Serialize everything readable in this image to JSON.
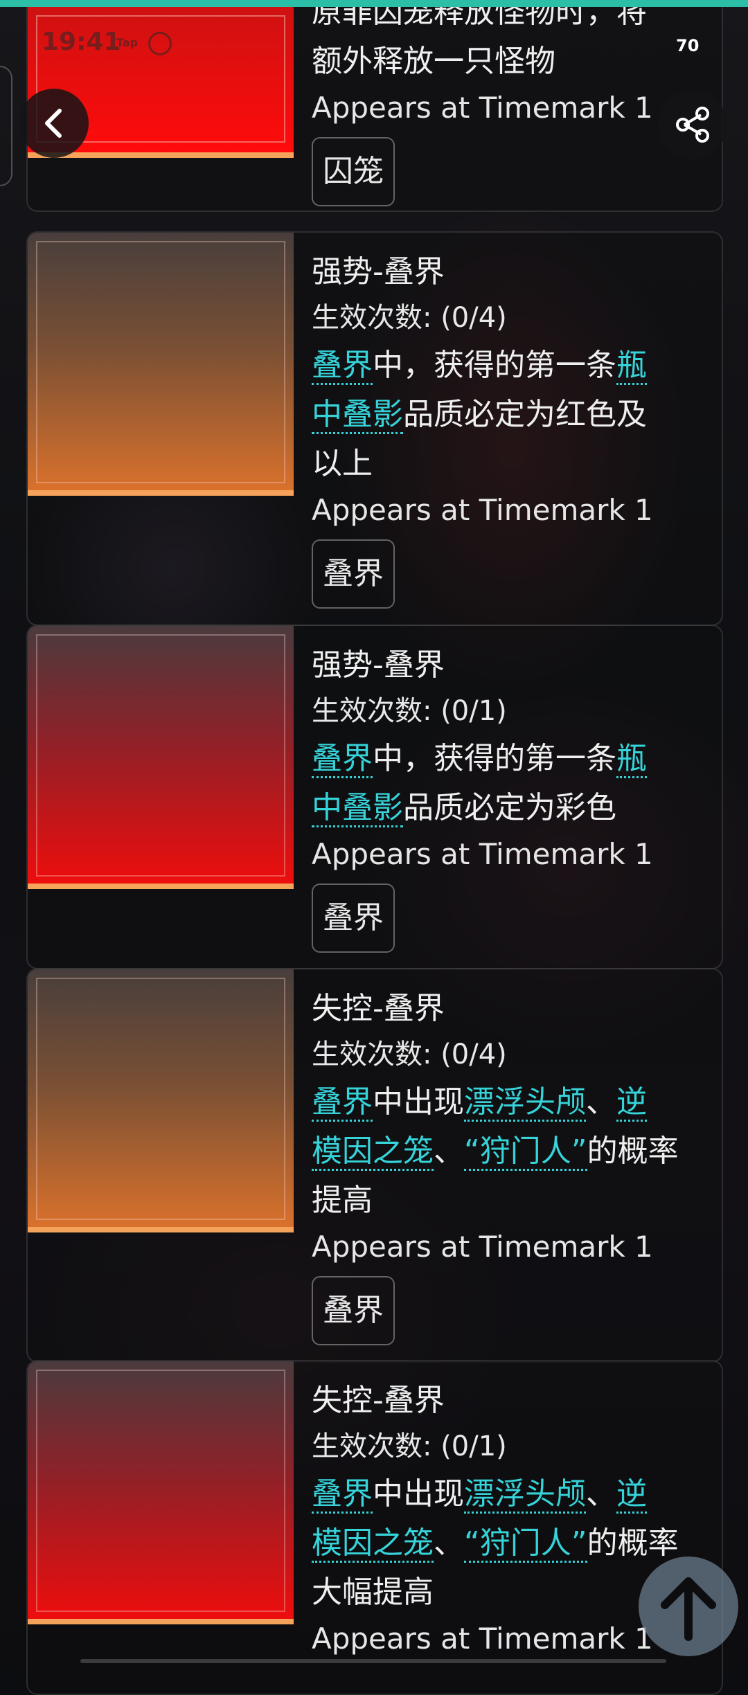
{
  "status_bar": {
    "time": "19:41",
    "tap_label": "Tap",
    "badge_number": "70"
  },
  "nav": {
    "back_icon": "chevron-left-icon",
    "share_icon": "share-icon"
  },
  "cards": [
    {
      "desc_lines": [
        "原罪囚笼释放怪物时，将",
        "额外释放一只怪物"
      ],
      "timemark": "Appears at Timemark 1",
      "tag": "囚笼"
    },
    {
      "title": "强势-叠界",
      "count": "生效次数: (0/4)",
      "desc": {
        "l1a": "叠界",
        "l1b": "中，获得的第一条",
        "l1c": "瓶",
        "l2a": "中叠影",
        "l2b": "品质必定为红色及",
        "l3": "以上"
      },
      "timemark": "Appears at Timemark 1",
      "tag": "叠界"
    },
    {
      "title": "强势-叠界",
      "count": "生效次数: (0/1)",
      "desc": {
        "l1a": "叠界",
        "l1b": "中，获得的第一条",
        "l1c": "瓶",
        "l2a": "中叠影",
        "l2b": "品质必定为彩色"
      },
      "timemark": "Appears at Timemark 1",
      "tag": "叠界"
    },
    {
      "title": "失控-叠界",
      "count": "生效次数: (0/4)",
      "desc": {
        "l1a": "叠界",
        "l1b": "中出现",
        "l1c": "漂浮头颅",
        "l1d": "、",
        "l1e": "逆",
        "l2a": "模因之笼",
        "l2b": "、",
        "l2c": "“狩门人”",
        "l2d": "的概率",
        "l3": "提高"
      },
      "timemark": "Appears at Timemark 1",
      "tag": "叠界"
    },
    {
      "title": "失控-叠界",
      "count": "生效次数: (0/1)",
      "desc": {
        "l1a": "叠界",
        "l1b": "中出现",
        "l1c": "漂浮头颅",
        "l1d": "、",
        "l1e": "逆",
        "l2a": "模因之笼",
        "l2b": "、",
        "l2c": "“狩门人”",
        "l2d": "的概率",
        "l3": "大幅提高"
      },
      "timemark": "Appears at Timemark 1"
    }
  ],
  "scroll_top_icon": "arrow-up-icon",
  "colors": {
    "accent_teal": "#36d3d9",
    "bar_orange": "#f5a35b",
    "top_line": "#2bbfa8"
  }
}
